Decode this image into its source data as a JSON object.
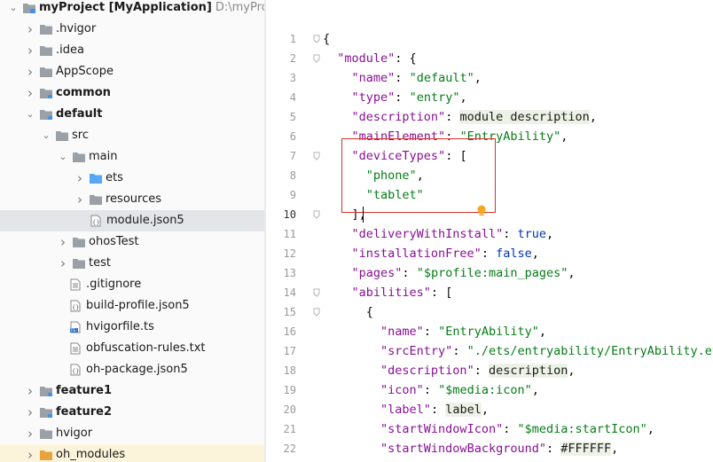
{
  "project_tree": {
    "root": {
      "name": "myProject",
      "module": "[MyApplication]",
      "path": "D:\\myProject"
    },
    "items": [
      {
        "label": "myProject [MyApplication]",
        "path": "D:\\myProject",
        "icon": "project-folder-icon",
        "arrow": "expanded",
        "bold": true,
        "depth": 0
      },
      {
        "label": ".hvigor",
        "icon": "folder-icon",
        "arrow": "collapsed",
        "bold": false,
        "depth": 1
      },
      {
        "label": ".idea",
        "icon": "folder-icon",
        "arrow": "collapsed",
        "bold": false,
        "depth": 1
      },
      {
        "label": "AppScope",
        "icon": "folder-icon",
        "arrow": "collapsed",
        "bold": false,
        "depth": 1
      },
      {
        "label": "common",
        "icon": "module-folder-icon",
        "arrow": "collapsed",
        "bold": true,
        "depth": 1
      },
      {
        "label": "default",
        "icon": "module-folder-icon",
        "arrow": "expanded",
        "bold": true,
        "depth": 1
      },
      {
        "label": "src",
        "icon": "folder-icon",
        "arrow": "expanded",
        "bold": false,
        "depth": 2
      },
      {
        "label": "main",
        "icon": "folder-icon",
        "arrow": "expanded",
        "bold": false,
        "depth": 3
      },
      {
        "label": "ets",
        "icon": "source-folder-icon",
        "arrow": "collapsed",
        "bold": false,
        "depth": 4
      },
      {
        "label": "resources",
        "icon": "folder-icon",
        "arrow": "collapsed",
        "bold": false,
        "depth": 4
      },
      {
        "label": "module.json5",
        "icon": "json5-file-icon",
        "arrow": "none",
        "bold": false,
        "depth": 5,
        "selected": true
      },
      {
        "label": "ohosTest",
        "icon": "folder-icon",
        "arrow": "collapsed",
        "bold": false,
        "depth": 3
      },
      {
        "label": "test",
        "icon": "folder-icon",
        "arrow": "collapsed",
        "bold": false,
        "depth": 3
      },
      {
        "label": ".gitignore",
        "icon": "text-file-icon",
        "arrow": "none",
        "bold": false,
        "depth": 3
      },
      {
        "label": "build-profile.json5",
        "icon": "json5-file-icon",
        "arrow": "none",
        "bold": false,
        "depth": 3
      },
      {
        "label": "hvigorfile.ts",
        "icon": "ts-file-icon",
        "arrow": "none",
        "bold": false,
        "depth": 3
      },
      {
        "label": "obfuscation-rules.txt",
        "icon": "text-file-icon",
        "arrow": "none",
        "bold": false,
        "depth": 3
      },
      {
        "label": "oh-package.json5",
        "icon": "json5-file-icon",
        "arrow": "none",
        "bold": false,
        "depth": 3
      },
      {
        "label": "feature1",
        "icon": "module-folder-icon",
        "arrow": "collapsed",
        "bold": true,
        "depth": 1
      },
      {
        "label": "feature2",
        "icon": "module-folder-icon",
        "arrow": "collapsed",
        "bold": true,
        "depth": 1
      },
      {
        "label": "hvigor",
        "icon": "folder-icon",
        "arrow": "collapsed",
        "bold": false,
        "depth": 1
      },
      {
        "label": "oh_modules",
        "icon": "library-folder-icon",
        "arrow": "collapsed",
        "bold": false,
        "depth": 1,
        "library": true
      }
    ]
  },
  "editor": {
    "current_line": 10,
    "lines": [
      {
        "n": "1",
        "tokens": [
          {
            "t": "{",
            "c": "p"
          }
        ]
      },
      {
        "n": "2",
        "tokens": [
          {
            "t": "  ",
            "c": "p"
          },
          {
            "t": "\"module\"",
            "c": "k"
          },
          {
            "t": ": {",
            "c": "p"
          }
        ]
      },
      {
        "n": "3",
        "tokens": [
          {
            "t": "    ",
            "c": "p"
          },
          {
            "t": "\"name\"",
            "c": "k"
          },
          {
            "t": ": ",
            "c": "p"
          },
          {
            "t": "\"default\"",
            "c": "s"
          },
          {
            "t": ",",
            "c": "p"
          }
        ]
      },
      {
        "n": "4",
        "tokens": [
          {
            "t": "    ",
            "c": "p"
          },
          {
            "t": "\"type\"",
            "c": "k"
          },
          {
            "t": ": ",
            "c": "p"
          },
          {
            "t": "\"entry\"",
            "c": "s"
          },
          {
            "t": ",",
            "c": "p"
          }
        ]
      },
      {
        "n": "5",
        "tokens": [
          {
            "t": "    ",
            "c": "p"
          },
          {
            "t": "\"description\"",
            "c": "k"
          },
          {
            "t": ": ",
            "c": "p"
          },
          {
            "t": "module description",
            "c": "hl"
          },
          {
            "t": ",",
            "c": "p"
          }
        ]
      },
      {
        "n": "6",
        "tokens": [
          {
            "t": "    ",
            "c": "p"
          },
          {
            "t": "\"mainElement\"",
            "c": "k"
          },
          {
            "t": ": ",
            "c": "p"
          },
          {
            "t": "\"EntryAbility\"",
            "c": "s"
          },
          {
            "t": ",",
            "c": "p"
          }
        ]
      },
      {
        "n": "7",
        "tokens": [
          {
            "t": "    ",
            "c": "p"
          },
          {
            "t": "\"deviceTypes\"",
            "c": "k"
          },
          {
            "t": ": [",
            "c": "p"
          }
        ]
      },
      {
        "n": "8",
        "tokens": [
          {
            "t": "      ",
            "c": "p"
          },
          {
            "t": "\"phone\"",
            "c": "s"
          },
          {
            "t": ",",
            "c": "p"
          }
        ]
      },
      {
        "n": "9",
        "tokens": [
          {
            "t": "      ",
            "c": "p"
          },
          {
            "t": "\"tablet\"",
            "c": "s"
          }
        ]
      },
      {
        "n": "10",
        "tokens": [
          {
            "t": "    ],",
            "c": "p"
          }
        ]
      },
      {
        "n": "11",
        "tokens": [
          {
            "t": "    ",
            "c": "p"
          },
          {
            "t": "\"deliveryWithInstall\"",
            "c": "k"
          },
          {
            "t": ": ",
            "c": "p"
          },
          {
            "t": "true",
            "c": "kw"
          },
          {
            "t": ",",
            "c": "p"
          }
        ]
      },
      {
        "n": "12",
        "tokens": [
          {
            "t": "    ",
            "c": "p"
          },
          {
            "t": "\"installationFree\"",
            "c": "k"
          },
          {
            "t": ": ",
            "c": "p"
          },
          {
            "t": "false",
            "c": "kw"
          },
          {
            "t": ",",
            "c": "p"
          }
        ]
      },
      {
        "n": "13",
        "tokens": [
          {
            "t": "    ",
            "c": "p"
          },
          {
            "t": "\"pages\"",
            "c": "k"
          },
          {
            "t": ": ",
            "c": "p"
          },
          {
            "t": "\"$profile:main_pages\"",
            "c": "s"
          },
          {
            "t": ",",
            "c": "p"
          }
        ]
      },
      {
        "n": "14",
        "tokens": [
          {
            "t": "    ",
            "c": "p"
          },
          {
            "t": "\"abilities\"",
            "c": "k"
          },
          {
            "t": ": [",
            "c": "p"
          }
        ]
      },
      {
        "n": "15",
        "tokens": [
          {
            "t": "      {",
            "c": "p"
          }
        ]
      },
      {
        "n": "16",
        "tokens": [
          {
            "t": "        ",
            "c": "p"
          },
          {
            "t": "\"name\"",
            "c": "k"
          },
          {
            "t": ": ",
            "c": "p"
          },
          {
            "t": "\"EntryAbility\"",
            "c": "s"
          },
          {
            "t": ",",
            "c": "p"
          }
        ]
      },
      {
        "n": "17",
        "tokens": [
          {
            "t": "        ",
            "c": "p"
          },
          {
            "t": "\"srcEntry\"",
            "c": "k"
          },
          {
            "t": ": ",
            "c": "p"
          },
          {
            "t": "\"./ets/entryability/EntryAbility.et",
            "c": "s"
          }
        ]
      },
      {
        "n": "18",
        "tokens": [
          {
            "t": "        ",
            "c": "p"
          },
          {
            "t": "\"description\"",
            "c": "k"
          },
          {
            "t": ": ",
            "c": "p"
          },
          {
            "t": "description",
            "c": "hl"
          },
          {
            "t": ",",
            "c": "p"
          }
        ]
      },
      {
        "n": "19",
        "tokens": [
          {
            "t": "        ",
            "c": "p"
          },
          {
            "t": "\"icon\"",
            "c": "k"
          },
          {
            "t": ": ",
            "c": "p"
          },
          {
            "t": "\"$media:icon\"",
            "c": "s"
          },
          {
            "t": ",",
            "c": "p"
          }
        ]
      },
      {
        "n": "20",
        "tokens": [
          {
            "t": "        ",
            "c": "p"
          },
          {
            "t": "\"label\"",
            "c": "k"
          },
          {
            "t": ": ",
            "c": "p"
          },
          {
            "t": "label",
            "c": "hl"
          },
          {
            "t": ",",
            "c": "p"
          }
        ]
      },
      {
        "n": "21",
        "tokens": [
          {
            "t": "        ",
            "c": "p"
          },
          {
            "t": "\"startWindowIcon\"",
            "c": "k"
          },
          {
            "t": ": ",
            "c": "p"
          },
          {
            "t": "\"$media:startIcon\"",
            "c": "s"
          },
          {
            "t": ",",
            "c": "p"
          }
        ]
      },
      {
        "n": "22",
        "tokens": [
          {
            "t": "        ",
            "c": "p"
          },
          {
            "t": "\"startWindowBackground\"",
            "c": "k"
          },
          {
            "t": ": ",
            "c": "p"
          },
          {
            "t": "#FFFFFF",
            "c": "hl"
          },
          {
            "t": ",",
            "c": "p"
          }
        ]
      }
    ],
    "highlight_box_color": "#d9302c",
    "intention_bulb_icon": "bulb-icon"
  }
}
